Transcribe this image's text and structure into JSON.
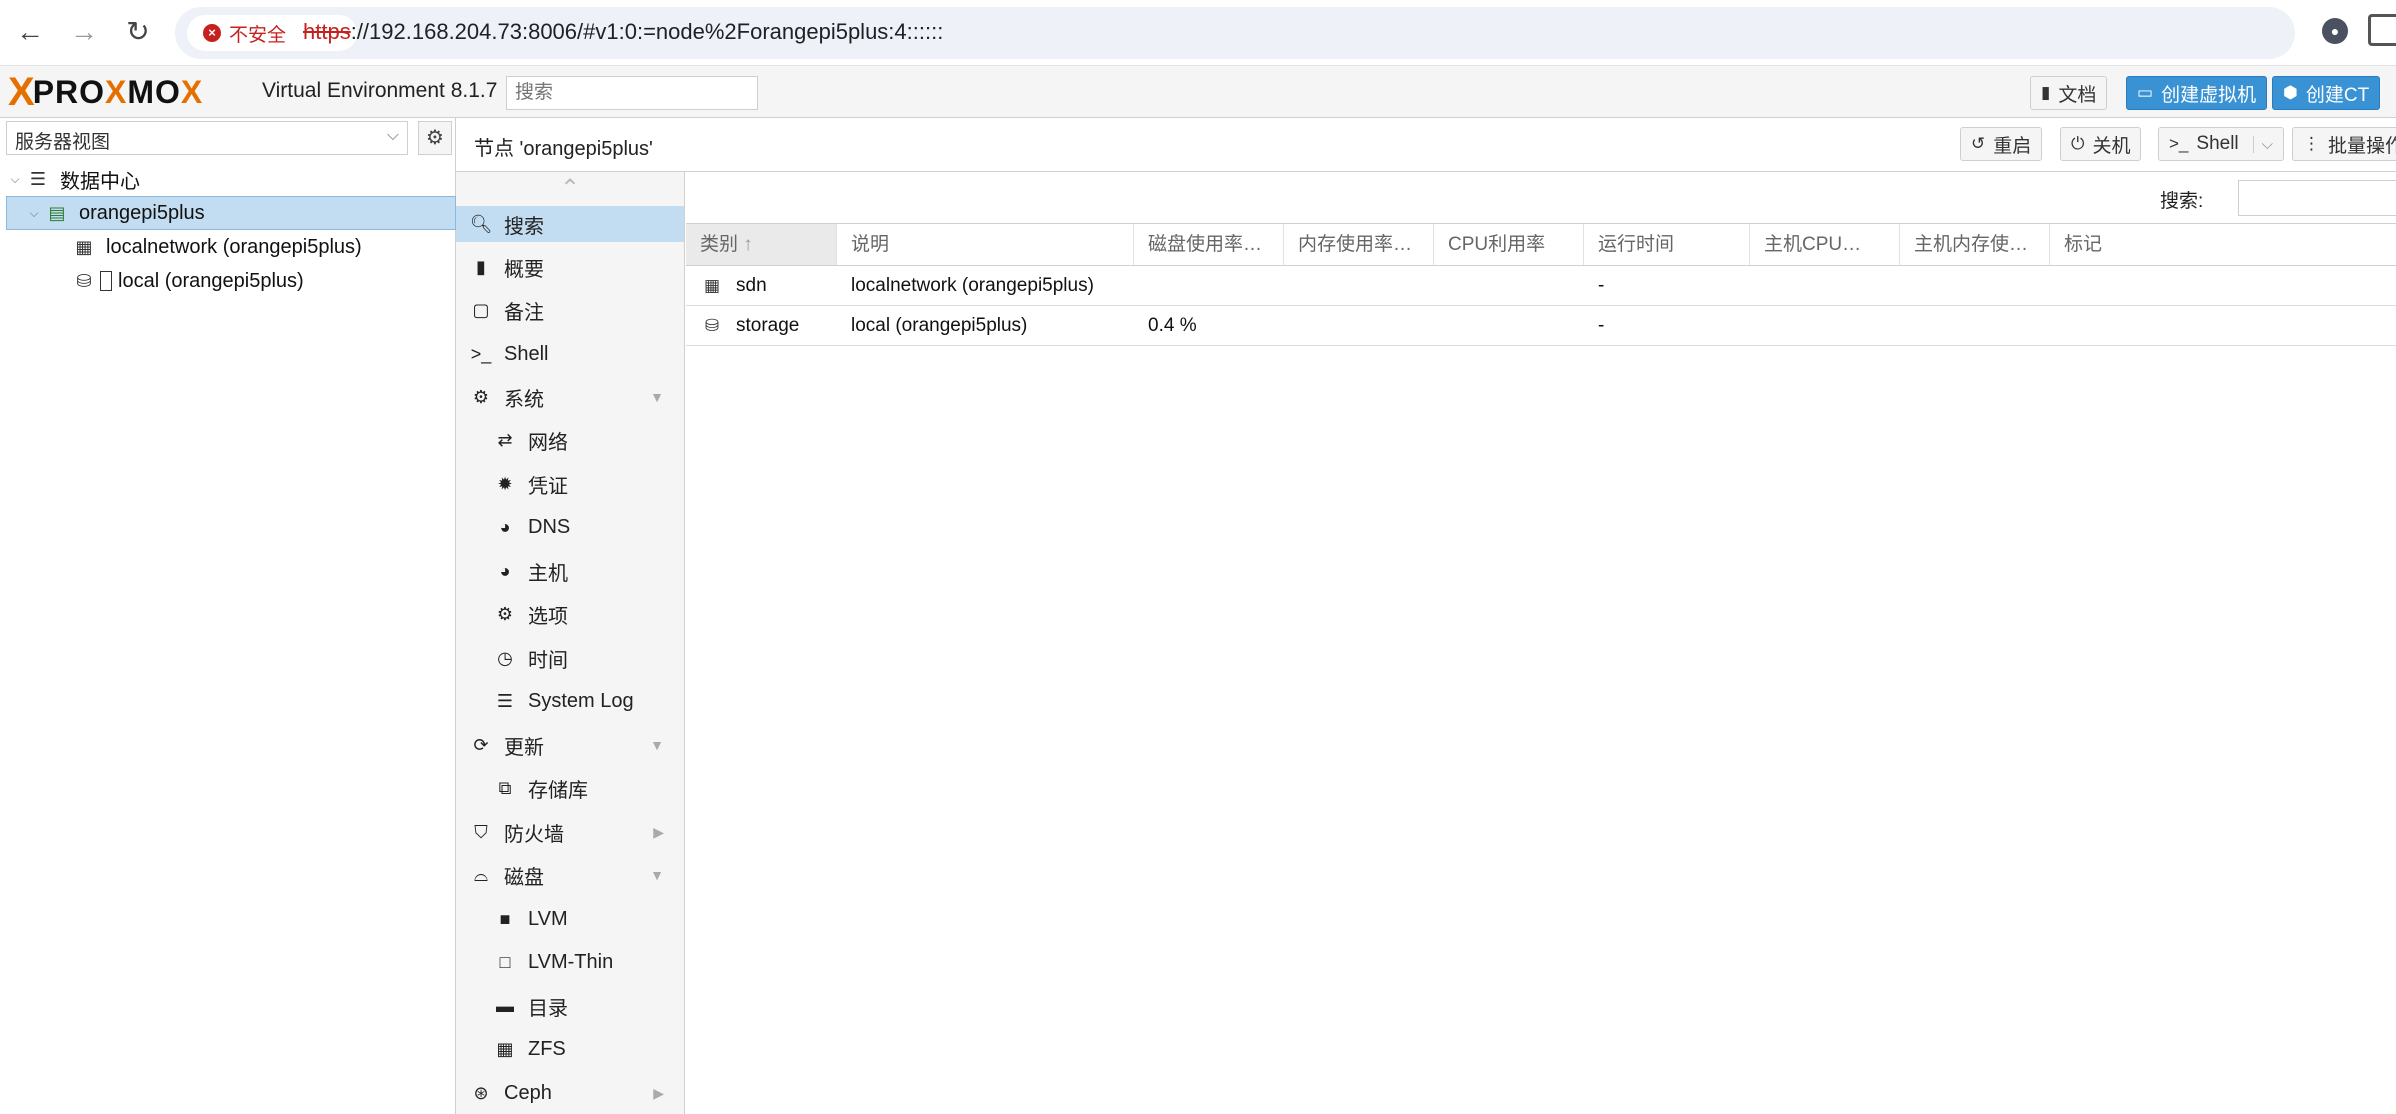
{
  "browser": {
    "security_label": "不安全",
    "url_scheme": "https",
    "url_rest": "://192.168.204.73:8006/#v1:0:=node%2Forangepi5plus:4::::::"
  },
  "header": {
    "logo_mark": "X",
    "logo_left": "PRO",
    "logo_x": "X",
    "logo_mid": "MO",
    "logo_x2": "X",
    "product": "Virtual Environment 8.1.7",
    "search_placeholder": "搜索",
    "docs_label": "文档",
    "create_vm_label": "创建虚拟机",
    "create_ct_label": "创建CT"
  },
  "tree": {
    "view_select": "服务器视图",
    "datacenter": "数据中心",
    "node": "orangepi5plus",
    "children": [
      {
        "label": "localnetwork (orangepi5plus)",
        "icon": "grid-icon"
      },
      {
        "label": "local (orangepi5plus)",
        "icon": "database-icon"
      }
    ]
  },
  "node_panel": {
    "title": "节点 'orangepi5plus'",
    "reboot_label": "重启",
    "shutdown_label": "关机",
    "shell_label": "Shell",
    "bulk_label": "批量操作"
  },
  "menu": {
    "items": [
      {
        "label": "搜索",
        "icon": "search-icon"
      },
      {
        "label": "概要",
        "icon": "book-icon"
      },
      {
        "label": "备注",
        "icon": "note-icon"
      },
      {
        "label": "Shell",
        "icon": "terminal-icon"
      },
      {
        "label": "系统",
        "icon": "cogs-icon"
      },
      {
        "label": "网络",
        "icon": "exchange-icon"
      },
      {
        "label": "凭证",
        "icon": "certificate-icon"
      },
      {
        "label": "DNS",
        "icon": "globe-icon"
      },
      {
        "label": "主机",
        "icon": "globe-icon"
      },
      {
        "label": "选项",
        "icon": "gear-icon"
      },
      {
        "label": "时间",
        "icon": "clock-icon"
      },
      {
        "label": "System Log",
        "icon": "list-icon"
      },
      {
        "label": "更新",
        "icon": "refresh-icon"
      },
      {
        "label": "存储库",
        "icon": "copy-icon"
      },
      {
        "label": "防火墙",
        "icon": "shield-icon"
      },
      {
        "label": "磁盘",
        "icon": "hdd-icon"
      },
      {
        "label": "LVM",
        "icon": "square-icon"
      },
      {
        "label": "LVM-Thin",
        "icon": "square-outline-icon"
      },
      {
        "label": "目录",
        "icon": "folder-icon"
      },
      {
        "label": "ZFS",
        "icon": "th-large-icon"
      },
      {
        "label": "Ceph",
        "icon": "ceph-icon"
      }
    ]
  },
  "grid": {
    "search_label": "搜索:",
    "columns": [
      "类别",
      "说明",
      "磁盘使用率…",
      "内存使用率…",
      "CPU利用率",
      "运行时间",
      "主机CPU…",
      "主机内存使…",
      "标记"
    ],
    "rows": [
      {
        "type": "sdn",
        "desc": "localnetwork (orangepi5plus)",
        "disk": "",
        "uptime": "-"
      },
      {
        "type": "storage",
        "desc": "local (orangepi5plus)",
        "disk": "0.4 %",
        "uptime": "-"
      }
    ]
  }
}
